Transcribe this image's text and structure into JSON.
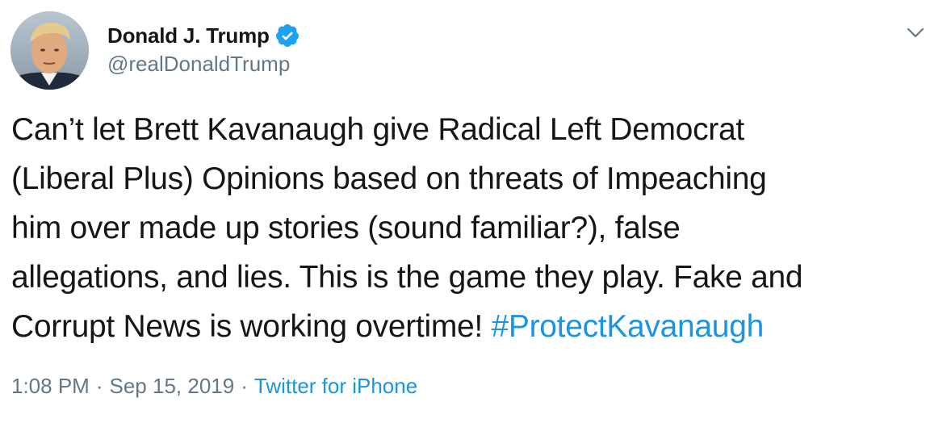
{
  "author": {
    "display_name": "Donald J. Trump",
    "handle": "@realDonaldTrump",
    "verified": true,
    "verified_icon": "verified-badge-icon",
    "avatar_icon": "profile-avatar"
  },
  "menu": {
    "icon": "chevron-down-icon"
  },
  "tweet": {
    "lines": [
      "Can’t let Brett Kavanaugh give Radical Left Democrat",
      "(Liberal Plus) Opinions based on threats of Impeaching",
      "him over made up stories (sound familiar?), false",
      "allegations, and lies. This is the game they play. Fake and",
      "Corrupt News is working overtime! "
    ],
    "hashtag": "#ProtectKavanaugh"
  },
  "meta": {
    "time": "1:08 PM",
    "separator": "·",
    "date": "Sep 15, 2019",
    "source": "Twitter for iPhone"
  },
  "colors": {
    "link": "#1b95e0",
    "secondary_text": "#657786",
    "primary_text": "#14171a",
    "verified": "#1da1f2"
  }
}
